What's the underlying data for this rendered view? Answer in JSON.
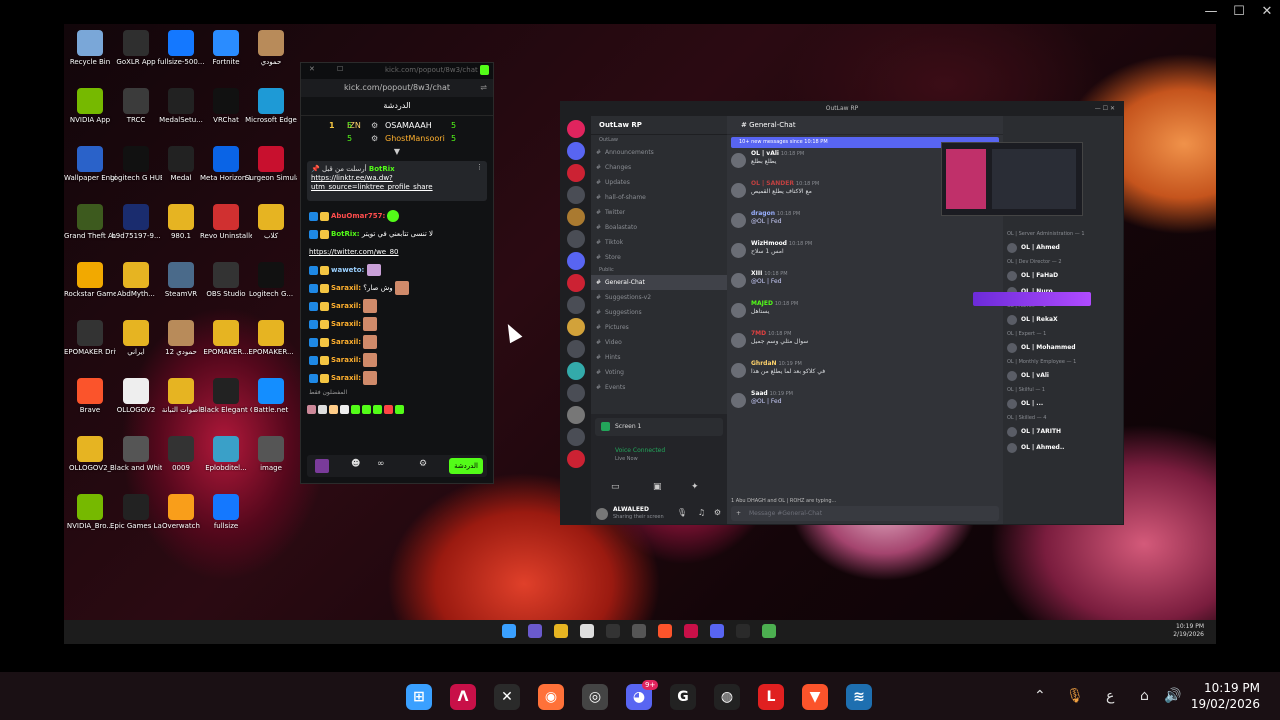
{
  "viewer": {
    "minimize": "—",
    "maximize": "☐",
    "close": "✕"
  },
  "desktop": {
    "icons": [
      {
        "label": "Recycle Bin",
        "color": "#7aa7d8"
      },
      {
        "label": "GoXLR App",
        "color": "#2f2f2f"
      },
      {
        "label": "fullsize-500...",
        "color": "#1478ff"
      },
      {
        "label": "Fortnite",
        "color": "#2a8cff"
      },
      {
        "label": "حمودي",
        "color": "#b88b5a"
      },
      {
        "label": "NVIDIA App",
        "color": "#76b900"
      },
      {
        "label": "TRCC",
        "color": "#3b3b3b"
      },
      {
        "label": "MedalSetu...",
        "color": "#222"
      },
      {
        "label": "VRChat",
        "color": "#111"
      },
      {
        "label": "Microsoft Edge",
        "color": "#1e9ad6"
      },
      {
        "label": "Wallpaper Engine",
        "color": "#2a62c9"
      },
      {
        "label": "Logitech G HUB",
        "color": "#111"
      },
      {
        "label": "Medal",
        "color": "#222"
      },
      {
        "label": "Meta Horizon Link",
        "color": "#0a64e6"
      },
      {
        "label": "Surgeon Simulato...",
        "color": "#c8102e"
      },
      {
        "label": "Grand Theft Auto V",
        "color": "#3d5a1e"
      },
      {
        "label": "b9d75197-9...",
        "color": "#1a2c6e"
      },
      {
        "label": "980.1",
        "color": "#e6b422"
      },
      {
        "label": "Revo Uninstaller",
        "color": "#d03030"
      },
      {
        "label": "كلاب",
        "color": "#e6b422"
      },
      {
        "label": "Rockstar Games...",
        "color": "#f2a900"
      },
      {
        "label": "AbdMyth...",
        "color": "#e6b422"
      },
      {
        "label": "SteamVR",
        "color": "#4a6a8a"
      },
      {
        "label": "OBS Studio",
        "color": "#333"
      },
      {
        "label": "Logitech G...",
        "color": "#111"
      },
      {
        "label": "EPOMAKER Driver",
        "color": "#333"
      },
      {
        "label": "ايراني",
        "color": "#e6b422"
      },
      {
        "label": "حمودي 12",
        "color": "#b88b5a"
      },
      {
        "label": "EPOMAKER...",
        "color": "#e6b422"
      },
      {
        "label": "EPOMAKER...",
        "color": "#e6b422"
      },
      {
        "label": "Brave",
        "color": "#fb542b"
      },
      {
        "label": "OLLOGOV2",
        "color": "#eee"
      },
      {
        "label": "اصوات التبانة",
        "color": "#e6b422"
      },
      {
        "label": "Black Elegant Clean Simi...",
        "color": "#222"
      },
      {
        "label": "Battle.net",
        "color": "#148eff"
      },
      {
        "label": "OLLOGOV2_",
        "color": "#e6b422"
      },
      {
        "label": "Black and White Mo...",
        "color": "#555"
      },
      {
        "label": "0009",
        "color": "#333"
      },
      {
        "label": "Eplobditel...",
        "color": "#3aa0c8"
      },
      {
        "label": "image",
        "color": "#555"
      },
      {
        "label": "NVIDIA_Bro...",
        "color": "#76b900"
      },
      {
        "label": "Epic Games Launcher",
        "color": "#222"
      },
      {
        "label": "Overwatch",
        "color": "#f99e1a"
      },
      {
        "label": "fullsize",
        "color": "#1478ff"
      }
    ]
  },
  "kick": {
    "url": "kick.com/popout/8w3/chat",
    "title": "الدردشة",
    "leaderboard": [
      {
        "rank": "1",
        "name1": "IZN",
        "count1": "5",
        "name2": "OSAMAAAH",
        "count2": "5"
      },
      {
        "rank": "",
        "name1": "",
        "count1": "5",
        "name2": "GhostMansoori",
        "count2": "5"
      }
    ],
    "pinned": {
      "author": "BotRix",
      "prefix": "أرسلت من قبل",
      "link_line1": "https://linktr.ee/wa.dw?",
      "link_line2": "utm_source=linktree_profile_share"
    },
    "messages": [
      {
        "user": "AbuOmar757:",
        "text": "",
        "color": "#ff4d4d"
      },
      {
        "user": "BotRix:",
        "text": "لا تنسى تتابعني في تويتر",
        "color": "#53fc18"
      },
      {
        "user": "",
        "text": "https://twitter.com/we_80",
        "color": "#ffffff"
      },
      {
        "user": "waweto:",
        "text": "",
        "color": "#9ad0ff"
      },
      {
        "user": "Saraxil:",
        "text": "وش صار؟",
        "color": "#ffb02e"
      },
      {
        "user": "Saraxil:",
        "text": "",
        "color": "#ffb02e"
      },
      {
        "user": "Saraxil:",
        "text": "",
        "color": "#ffb02e"
      },
      {
        "user": "Saraxil:",
        "text": "",
        "color": "#ffb02e"
      },
      {
        "user": "Saraxil:",
        "text": "",
        "color": "#ffb02e"
      },
      {
        "user": "Saraxil:",
        "text": "",
        "color": "#ffb02e"
      }
    ],
    "emote_label": "المفضلون فقط",
    "send_button": "الدردشة"
  },
  "discord": {
    "title": "OutLaw RP",
    "server_name": "OutLaw RP",
    "new_banner": "10+ new messages since 10:18 PM",
    "search_placeholder": "Search OutLaw RP",
    "channel_header": "General-Chat",
    "channels": [
      {
        "name": "Announcements",
        "active": false
      },
      {
        "name": "Changes",
        "active": false
      },
      {
        "name": "Updates",
        "active": false
      },
      {
        "name": "hall-of-shame",
        "active": false
      },
      {
        "name": "Twitter",
        "active": false
      },
      {
        "name": "Boalastato",
        "active": false
      },
      {
        "name": "Tiktok",
        "active": false
      },
      {
        "name": "Store",
        "active": false
      },
      {
        "name": "General-Chat",
        "active": true
      },
      {
        "name": "Suggestions-v2",
        "active": false
      },
      {
        "name": "Suggestions",
        "active": false
      },
      {
        "name": "Pictures",
        "active": false
      },
      {
        "name": "Video",
        "active": false
      },
      {
        "name": "Hints",
        "active": false
      },
      {
        "name": "Voting",
        "active": false
      },
      {
        "name": "Events",
        "active": false
      }
    ],
    "categories": {
      "top": "OutLaw",
      "public": "Public"
    },
    "screen_label": "Screen 1",
    "voice_status": "Voice Connected",
    "voice_sub": "Live Now",
    "user_name": "ALWALEED",
    "user_status": "Sharing their screen",
    "messages": [
      {
        "author": "OL | vAli",
        "time": "10:18 PM",
        "color": "#ffffff",
        "text": "يطلع بطلع"
      },
      {
        "author": "OL | SANDER",
        "time": "10:18 PM",
        "color": "#c04040",
        "text": "مع الاكتاف يطلع القميص"
      },
      {
        "author": "dragon",
        "time": "10:18 PM",
        "color": "#9ab0ff",
        "text": "@OL | Fed"
      },
      {
        "author": "WizHmood",
        "time": "10:18 PM",
        "color": "#ffffff",
        "text": "امس 1 سلاح"
      },
      {
        "author": "XIII",
        "time": "10:18 PM",
        "color": "#ffffff",
        "text": "@OL | Fed"
      },
      {
        "author": "MAJED",
        "time": "10:18 PM",
        "color": "#53fc18",
        "text": "يستاهل"
      },
      {
        "author": "7MD",
        "time": "10:18 PM",
        "color": "#e04040",
        "text": "سوال مثلي وسم جميل"
      },
      {
        "author": "GhrdaN",
        "time": "10:19 PM",
        "color": "#ffd36b",
        "text": "في كلاكو بعد لما يطلع من هذا"
      },
      {
        "author": "Saad",
        "time": "10:19 PM",
        "color": "#ffffff",
        "text": "@OL | Fed"
      }
    ],
    "typing": "1 Abu DHAGH and OL | ROHZ are typing...",
    "message_placeholder": "Message #General-Chat",
    "member_roles": [
      {
        "role": "OL | Server Administration — 1",
        "members": [
          "OL | Ahmed"
        ]
      },
      {
        "role": "OL | Dev Director — 2",
        "members": [
          "OL | FaHaD",
          "OL | Nuro"
        ]
      },
      {
        "role": "OL | Admin — 1",
        "members": [
          "OL | RekaX"
        ]
      },
      {
        "role": "OL | Expert — 1",
        "members": [
          "OL | Mohammed"
        ]
      },
      {
        "role": "OL | Monthly Employee — 1",
        "members": [
          "OL | vAli"
        ]
      },
      {
        "role": "OL | Skilful — 1",
        "members": [
          "OL | ..."
        ]
      },
      {
        "role": "OL | Skilled — 4",
        "members": [
          "OL | 7ARITH",
          "OL | Ahmed.."
        ]
      }
    ]
  },
  "inner_taskbar": {
    "time": "10:19 PM",
    "date": "2/19/2026"
  },
  "taskbar": {
    "apps": [
      {
        "name": "windows-start",
        "color": "#3aa0ff",
        "glyph": "⊞"
      },
      {
        "name": "app-a",
        "color": "#c81048",
        "glyph": "Λ"
      },
      {
        "name": "xbox",
        "color": "#2a2a2a",
        "glyph": "✕"
      },
      {
        "name": "firefox",
        "color": "#ff7139",
        "glyph": "◉"
      },
      {
        "name": "steam-like",
        "color": "#444",
        "glyph": "◎"
      },
      {
        "name": "discord",
        "color": "#5865f2",
        "glyph": "◕"
      },
      {
        "name": "logitech",
        "color": "#222",
        "glyph": "G"
      },
      {
        "name": "obs",
        "color": "#222",
        "glyph": "◍"
      },
      {
        "name": "app-red",
        "color": "#e02020",
        "glyph": "L"
      },
      {
        "name": "brave",
        "color": "#fb542b",
        "glyph": "▼"
      },
      {
        "name": "app-wing",
        "color": "#1e6fb0",
        "glyph": "≋"
      }
    ],
    "discord_badge": "9+",
    "tray_lang": "ع",
    "clock_time": "10:19 PM",
    "clock_date": "19/02/2026"
  }
}
